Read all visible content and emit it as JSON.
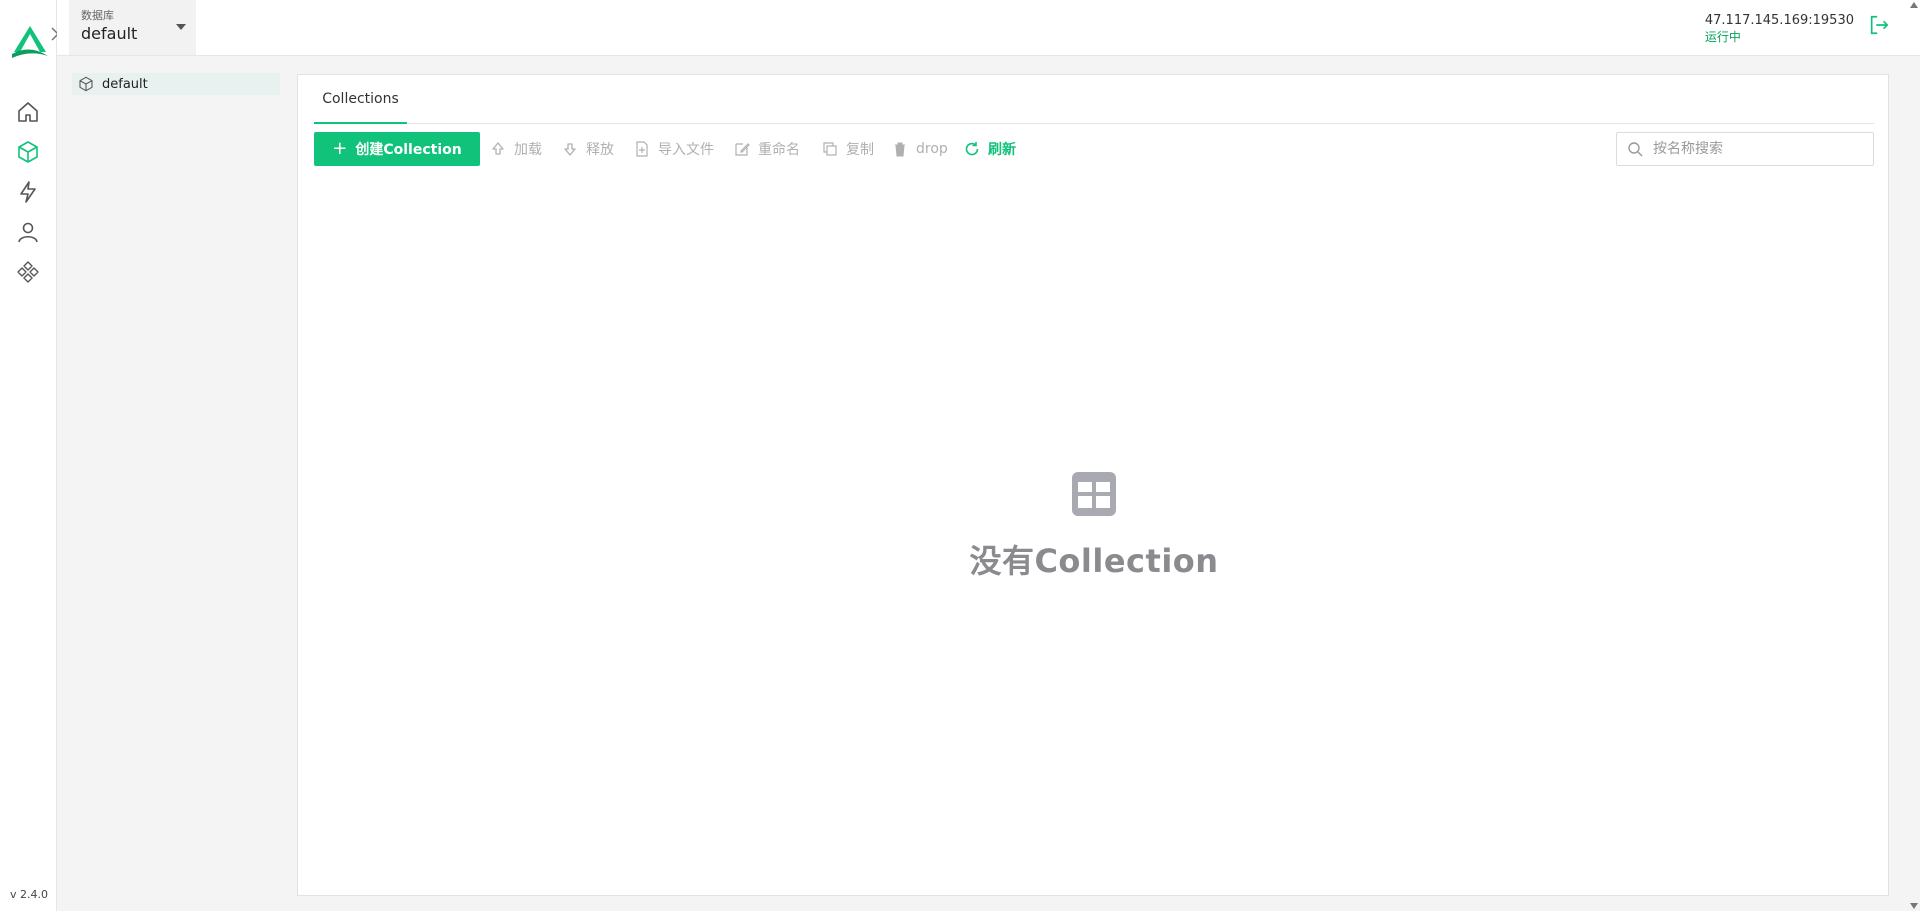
{
  "app": {
    "version": "v 2.4.0",
    "colors": {
      "accent": "#10c27a",
      "status_ok": "#06a35a",
      "muted": "#b0b0b0"
    }
  },
  "rail": {
    "items": [
      {
        "icon": "home-icon"
      },
      {
        "icon": "database-cube-icon",
        "active": true
      },
      {
        "icon": "lightning-icon"
      },
      {
        "icon": "user-icon"
      },
      {
        "icon": "plugins-icon"
      }
    ]
  },
  "header": {
    "db_label": "数据库",
    "db_value": "default",
    "address": "47.117.145.169:19530",
    "status": "运行中"
  },
  "sidebar": {
    "items": [
      {
        "label": "default",
        "icon": "cube-icon"
      }
    ]
  },
  "main": {
    "tabs": [
      {
        "label": "Collections"
      }
    ],
    "toolbar": {
      "create_label": "创建Collection",
      "load_label": "加载",
      "release_label": "释放",
      "import_label": "导入文件",
      "rename_label": "重命名",
      "duplicate_label": "复制",
      "drop_label": "drop",
      "refresh_label": "刷新"
    },
    "search": {
      "placeholder": "按名称搜索",
      "value": ""
    },
    "empty_text": "没有Collection"
  }
}
